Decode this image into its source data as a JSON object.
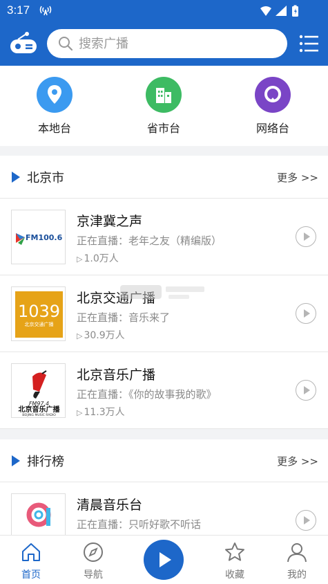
{
  "status": {
    "time": "3:17"
  },
  "search": {
    "placeholder": "搜索广播"
  },
  "categories": [
    {
      "label": "本地台",
      "color": "#3b9af0",
      "icon": "location-pin-icon"
    },
    {
      "label": "省市台",
      "color": "#3dbb63",
      "icon": "building-icon"
    },
    {
      "label": "网络台",
      "color": "#7a45c6",
      "icon": "network-icon"
    }
  ],
  "sections": [
    {
      "title": "北京市",
      "more": "更多 >>",
      "items": [
        {
          "name": "京津冀之声",
          "live": "正在直播：老年之友（精编版）",
          "count": "1.0万人",
          "logo_text": "FM100.6"
        },
        {
          "name": "北京交通广播",
          "live": "正在直播：音乐来了",
          "count": "30.9万人",
          "logo_text": "1039",
          "logo_sub": "北京交通广播"
        },
        {
          "name": "北京音乐广播",
          "live": "正在直播：《你的故事我的歌》",
          "count": "11.3万人",
          "logo_text": "FM97.4",
          "logo_sub": "北京音乐广播",
          "logo_sub2": "BEIJING MUSIC RADIO"
        }
      ]
    },
    {
      "title": "排行榜",
      "more": "更多 >>",
      "items": [
        {
          "name": "清晨音乐台",
          "live": "正在直播：只听好歌不听话"
        }
      ]
    }
  ],
  "tabs": [
    {
      "label": "首页",
      "icon": "home-icon"
    },
    {
      "label": "导航",
      "icon": "compass-icon"
    },
    {
      "label": "收藏",
      "icon": "star-icon"
    },
    {
      "label": "我的",
      "icon": "user-icon"
    }
  ],
  "colors": {
    "primary": "#1d67c9",
    "divider": "#e6e6e6",
    "page_bg": "#f2f3f5"
  }
}
